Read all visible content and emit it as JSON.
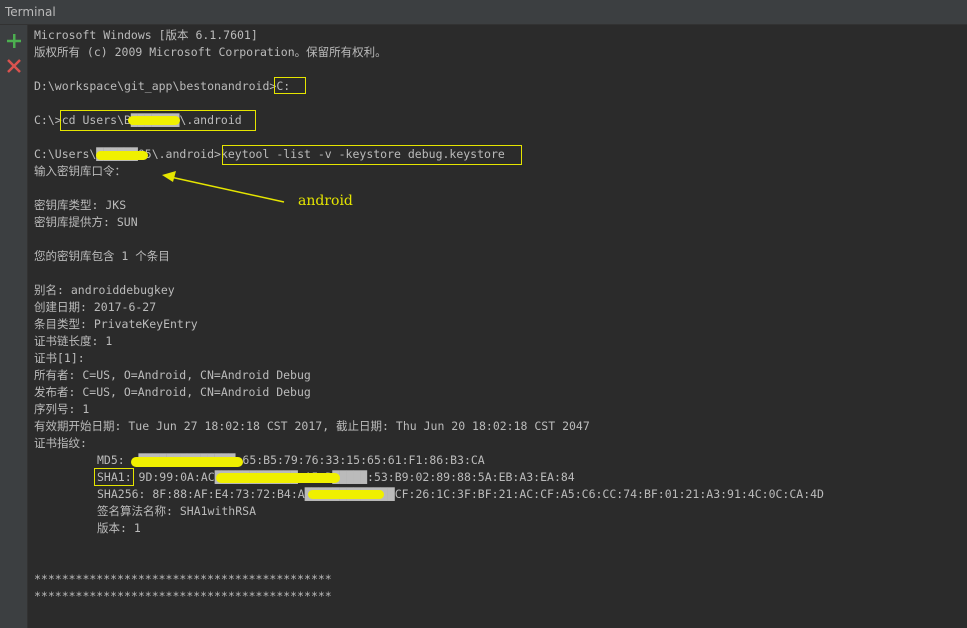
{
  "window": {
    "title": "Terminal"
  },
  "sidebar": {
    "add_icon_color": "#4caf50",
    "close_icon_color": "#d9534f"
  },
  "terminal": {
    "lines": [
      "Microsoft Windows [版本 6.1.7601]",
      "版权所有 (c) 2009 Microsoft Corporation。保留所有权利。",
      "",
      "D:\\workspace\\git_app\\bestonandroid>C:",
      "",
      "C:\\>cd Users\\B███████\\.android",
      "",
      "C:\\Users\\██████05\\.android>keytool -list -v -keystore debug.keystore",
      "输入密钥库口令：",
      "",
      "密钥库类型: JKS",
      "密钥库提供方: SUN",
      "",
      "您的密钥库包含 1 个条目",
      "",
      "别名: androiddebugkey",
      "创建日期: 2017-6-27",
      "条目类型: PrivateKeyEntry",
      "证书链长度: 1",
      "证书[1]:",
      "所有者: C=US, O=Android, CN=Android Debug",
      "发布者: C=US, O=Android, CN=Android Debug",
      "序列号: 1",
      "有效期开始日期: Tue Jun 27 18:02:18 CST 2017, 截止日期: Thu Jun 20 18:02:18 CST 2047",
      "证书指纹:",
      "MD5:  ██████████████:65:B5:79:76:33:15:65:61:F1:86:B3:CA",
      "SHA1: 9D:99:0A:AC████████████:A5:D█████:53:B9:02:89:88:5A:EB:A3:EA:84",
      "SHA256: 8F:88:AF:E4:73:72:B4:A█████████████CF:26:1C:3F:BF:21:AC:CF:A5:C6:CC:74:BF:01:21:A3:91:4C:0C:CA:4D",
      "签名算法名称: SHA1withRSA",
      "版本: 1",
      "",
      "",
      "",
      "*******************************************",
      "*******************************************"
    ]
  },
  "annotation": {
    "label": "android",
    "color": "#e5e500"
  }
}
